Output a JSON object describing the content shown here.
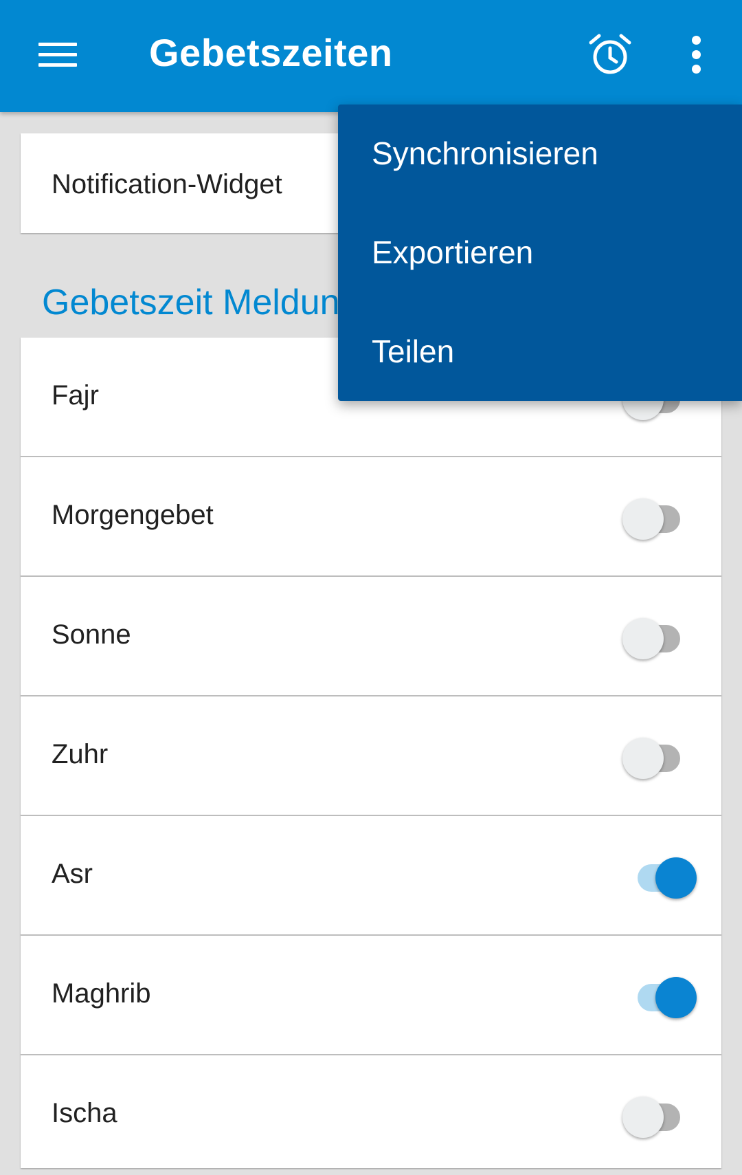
{
  "appbar": {
    "title": "Gebetszeiten",
    "menu_icon": "hamburger-menu-icon",
    "alarm_icon": "alarm-clock-icon",
    "overflow_icon": "more-vertical-icon",
    "color": "#0288d1"
  },
  "widget": {
    "label": "Notification-Widget"
  },
  "section": {
    "title": "Gebetszeit Meldungen"
  },
  "prayers": [
    {
      "label": "Fajr",
      "enabled": false
    },
    {
      "label": "Morgengebet",
      "enabled": false
    },
    {
      "label": "Sonne",
      "enabled": false
    },
    {
      "label": "Zuhr",
      "enabled": false
    },
    {
      "label": "Asr",
      "enabled": true
    },
    {
      "label": "Maghrib",
      "enabled": true
    },
    {
      "label": "Ischa",
      "enabled": false
    }
  ],
  "overflow_menu": {
    "items": [
      "Synchronisieren",
      "Exportieren",
      "Teilen"
    ],
    "color": "#01579b"
  },
  "colors": {
    "switch_on": "#0a84d2",
    "switch_on_track": "#afd9f1",
    "switch_off_track": "#b3b3b3"
  }
}
